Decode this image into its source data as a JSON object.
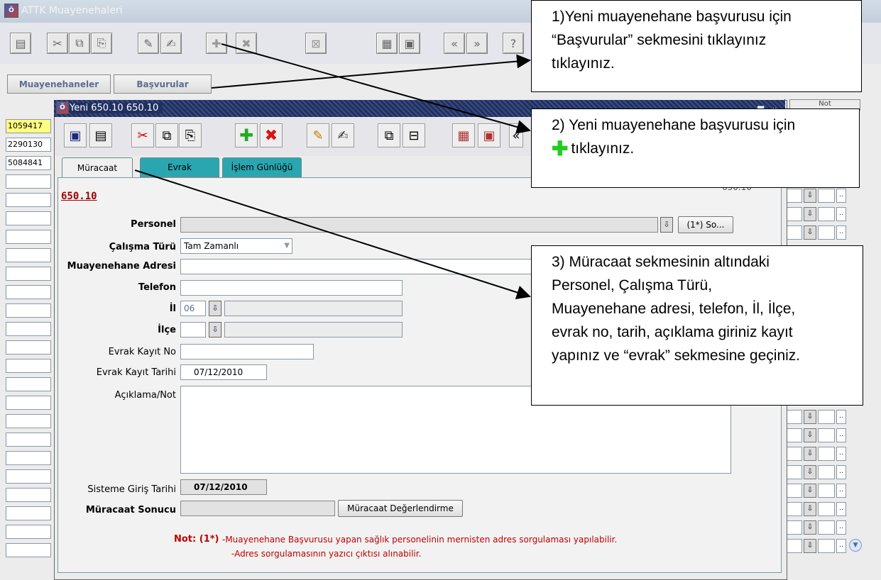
{
  "outer": {
    "title": "ATTK Muayenehaleri",
    "tabs": [
      "Muayenehaneler",
      "Başvurular"
    ]
  },
  "left_list": [
    "1059417",
    "2290130",
    "5084841"
  ],
  "right_col": {
    "header": "Not"
  },
  "inner": {
    "title": "Yeni 650.10 650.10",
    "tabs": [
      "Müracaat",
      "Evrak",
      "İşlem Günlüğü"
    ],
    "code": "650.10",
    "code_right": "650.10",
    "form": {
      "personel_label": "Personel",
      "personel_button": "(1*) So...",
      "calisma_label": "Çalışma Türü",
      "calisma_value": "Tam Zamanlı",
      "adres_label": "Muayenehane Adresi",
      "telefon_label": "Telefon",
      "il_label": "İl",
      "il_value": "06",
      "ilce_label": "İlçe",
      "evrak_no_label": "Evrak Kayıt No",
      "evrak_tarih_label": "Evrak Kayıt Tarihi",
      "evrak_tarih_value": "07/12/2010",
      "aciklama_label": "Açıklama/Not",
      "sisteme_giris_label": "Sisteme Giriş Tarihi",
      "sisteme_giris_value": "07/12/2010",
      "sonuc_label": "Müracaat Sonucu",
      "degerlendirme_button": "Müracaat Değerlendirme"
    },
    "note": {
      "prefix": "Not: (1*)",
      "line1": "-Muayenehane Başvurusu yapan sağlık personelinin mernisten adres sorgulaması yapılabilir.",
      "line2": "-Adres sorgulamasının yazıcı çıktısı alınabilir."
    }
  },
  "callouts": {
    "c1": [
      "1)Yeni muayenehane başvurusu için",
      "“Başvurular” sekmesini tıklayınız",
      "tıklayınız."
    ],
    "c2": [
      "2) Yeni muayenehane başvurusu için",
      "tıklayınız."
    ],
    "c3": [
      "3) Müracaat sekmesinin altındaki",
      "Personel, Çalışma Türü,",
      "Muayenehane adresi, telefon, İl, İlçe,",
      "evrak no, tarih,  açıklama giriniz kayıt",
      "yapınız ve “evrak” sekmesine geçiniz."
    ]
  },
  "colors": {
    "accent_red": "#c00000",
    "tab_teal": "#2aa6b0",
    "titlebar_navy": "#203060",
    "plus_green": "#22aa22"
  }
}
